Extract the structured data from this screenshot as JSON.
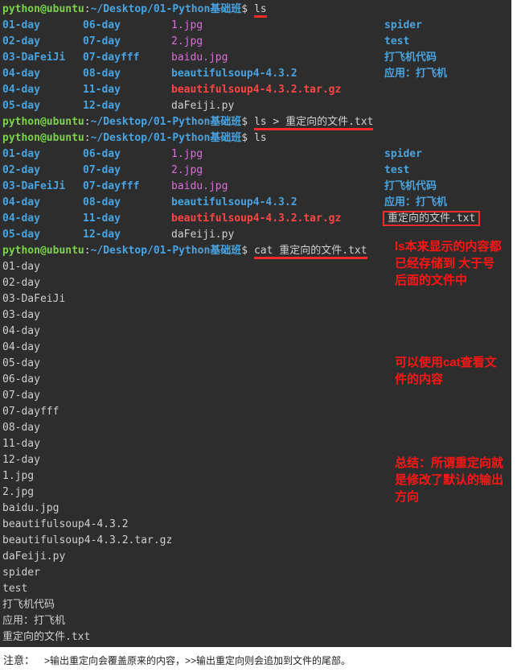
{
  "prompt": {
    "user": "python@ubuntu",
    "sep1": ":",
    "path": "~/Desktop/01-Python基础班",
    "dollar": "$"
  },
  "cmd1": "ls",
  "cmd2": "ls > 重定向的文件.txt",
  "cmd3": "ls",
  "cmd4": "cat 重定向的文件.txt",
  "ls1": {
    "rows": [
      {
        "c1": "01-day",
        "c2": "06-day",
        "c3": "1.jpg",
        "c4": "spider"
      },
      {
        "c1": "02-day",
        "c2": "07-day",
        "c3": "2.jpg",
        "c4": "test"
      },
      {
        "c1": "03-DaFeiJi",
        "c2": "07-dayfff",
        "c3": "baidu.jpg",
        "c4": "打飞机代码"
      },
      {
        "c1": "04-day",
        "c2": "08-day",
        "c3": "beautifulsoup4-4.3.2",
        "c4": "应用：打飞机"
      },
      {
        "c1": "04-day",
        "c2": "11-day",
        "c3": "beautifulsoup4-4.3.2.tar.gz",
        "c4": ""
      },
      {
        "c1": "05-day",
        "c2": "12-day",
        "c3": "daFeiji.py",
        "c4": ""
      }
    ]
  },
  "ls2": {
    "rows": [
      {
        "c1": "01-day",
        "c2": "06-day",
        "c3": "1.jpg",
        "c4": "spider"
      },
      {
        "c1": "02-day",
        "c2": "07-day",
        "c3": "2.jpg",
        "c4": "test"
      },
      {
        "c1": "03-DaFeiJi",
        "c2": "07-dayfff",
        "c3": "baidu.jpg",
        "c4": "打飞机代码"
      },
      {
        "c1": "04-day",
        "c2": "08-day",
        "c3": "beautifulsoup4-4.3.2",
        "c4": "应用：打飞机"
      },
      {
        "c1": "04-day",
        "c2": "11-day",
        "c3": "beautifulsoup4-4.3.2.tar.gz",
        "c4": "重定向的文件.txt"
      },
      {
        "c1": "05-day",
        "c2": "12-day",
        "c3": "daFeiji.py",
        "c4": ""
      }
    ]
  },
  "cat_output": [
    "01-day",
    "02-day",
    "03-DaFeiJi",
    "03-day",
    "04-day",
    "04-day",
    "05-day",
    "06-day",
    "07-day",
    "07-dayfff",
    "08-day",
    "11-day",
    "12-day",
    "1.jpg",
    "2.jpg",
    "baidu.jpg",
    "beautifulsoup4-4.3.2",
    "beautifulsoup4-4.3.2.tar.gz",
    "daFeiji.py",
    "spider",
    "test",
    "打飞机代码",
    "应用：打飞机",
    "重定向的文件.txt"
  ],
  "ann1": "ls本来显示的内容都已经存储到  大于号后面的文件中",
  "ann2": "可以使用cat查看文件的内容",
  "ann3": "总结：所谓重定向就是修改了默认的输出方向",
  "footer": {
    "label": "注意：",
    "text": ">输出重定向会覆盖原来的内容，>>输出重定向则会追加到文件的尾部。"
  }
}
